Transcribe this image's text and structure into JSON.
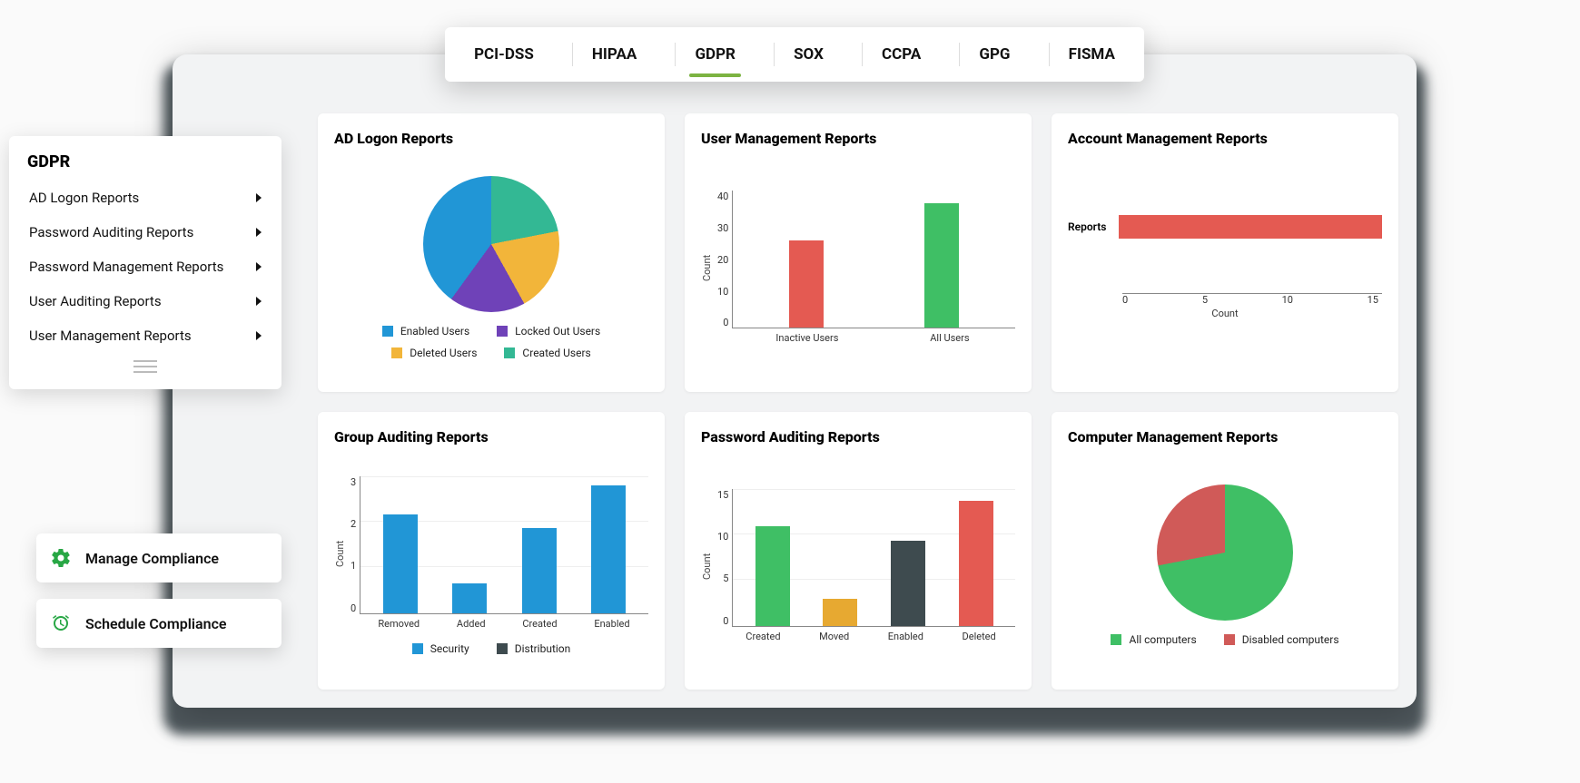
{
  "tabs": [
    "PCI-DSS",
    "HIPAA",
    "GDPR",
    "SOX",
    "CCPA",
    "GPG",
    "FISMA"
  ],
  "active_tab": "GDPR",
  "sidebar": {
    "title": "GDPR",
    "items": [
      "AD Logon Reports",
      "Password Auditing Reports",
      "Password Management Reports",
      "User Auditing Reports",
      "User Management Reports"
    ]
  },
  "actions": {
    "manage": "Manage Compliance",
    "schedule": "Schedule Compliance"
  },
  "cards": {
    "ad_logon": {
      "title": "AD Logon Reports",
      "legend": [
        "Enabled Users",
        "Locked Out Users",
        "Deleted Users",
        "Created Users"
      ]
    },
    "user_mgmt": {
      "title": "User Management Reports",
      "ylabel": "Count",
      "yticks": [
        "40",
        "30",
        "20",
        "10",
        "0"
      ],
      "categories": [
        "Inactive Users",
        "All Users"
      ]
    },
    "acct_mgmt": {
      "title": "Account Management Reports",
      "row_label": "Reports",
      "xlabel": "Count",
      "xticks": [
        "0",
        "5",
        "10",
        "15"
      ]
    },
    "group_audit": {
      "title": "Group Auditing Reports",
      "ylabel": "Count",
      "yticks": [
        "3",
        "2",
        "1",
        "0"
      ],
      "categories": [
        "Removed",
        "Added",
        "Created",
        "Enabled"
      ],
      "legend": [
        "Security",
        "Distribution"
      ]
    },
    "pwd_audit": {
      "title": "Password Auditing Reports",
      "ylabel": "Count",
      "yticks": [
        "15",
        "10",
        "5",
        "0"
      ],
      "categories": [
        "Created",
        "Moved",
        "Enabled",
        "Deleted"
      ]
    },
    "comp_mgmt": {
      "title": "Computer Management Reports",
      "legend": [
        "All computers",
        "Disabled computers"
      ]
    }
  },
  "colors": {
    "blue": "#2196d6",
    "purple": "#6f42b8",
    "yellow": "#f2b53a",
    "teal": "#33b894",
    "green": "#3fbf65",
    "orange": "#e7a931",
    "dark": "#3e4b4f",
    "red": "#e45a52",
    "accent_green": "#28a745"
  },
  "chart_data": [
    {
      "id": "ad_logon",
      "type": "pie",
      "title": "AD Logon Reports",
      "series": [
        {
          "name": "Enabled Users",
          "value": 40,
          "color": "#2196d6"
        },
        {
          "name": "Deleted Users",
          "value": 20,
          "color": "#f2b53a"
        },
        {
          "name": "Created Users",
          "value": 22,
          "color": "#33b894"
        },
        {
          "name": "Locked Out Users",
          "value": 18,
          "color": "#6f42b8"
        }
      ]
    },
    {
      "id": "user_mgmt",
      "type": "bar",
      "title": "User Management Reports",
      "ylabel": "Count",
      "ylim": [
        0,
        45
      ],
      "categories": [
        "Inactive Users",
        "All Users"
      ],
      "series": [
        {
          "name": "Inactive Users",
          "value": 29,
          "color": "#e45a52"
        },
        {
          "name": "All Users",
          "value": 41,
          "color": "#3fbf65"
        }
      ]
    },
    {
      "id": "acct_mgmt",
      "type": "bar",
      "orientation": "horizontal",
      "title": "Account Management Reports",
      "xlabel": "Count",
      "xlim": [
        0,
        15
      ],
      "categories": [
        "Reports"
      ],
      "values": [
        15
      ],
      "color": "#e45a52"
    },
    {
      "id": "group_audit",
      "type": "bar",
      "title": "Group Auditing Reports",
      "ylabel": "Count",
      "ylim": [
        0,
        3
      ],
      "categories": [
        "Removed",
        "Added",
        "Created",
        "Enabled"
      ],
      "series": [
        {
          "name": "Security",
          "color": "#2196d6",
          "values": [
            2.15,
            0.65,
            1.85,
            2.8
          ]
        },
        {
          "name": "Distribution",
          "color": "#3e4b4f",
          "values": [
            0,
            0,
            0,
            0
          ]
        }
      ]
    },
    {
      "id": "pwd_audit",
      "type": "bar",
      "title": "Password Auditing Reports",
      "ylabel": "Count",
      "ylim": [
        0,
        15
      ],
      "categories": [
        "Created",
        "Moved",
        "Enabled",
        "Deleted"
      ],
      "series": [
        {
          "name": "Created",
          "value": 11,
          "color": "#3fbf65"
        },
        {
          "name": "Moved",
          "value": 3,
          "color": "#e7a931"
        },
        {
          "name": "Enabled",
          "value": 9.3,
          "color": "#3e4b4f"
        },
        {
          "name": "Deleted",
          "value": 13.7,
          "color": "#e45a52"
        }
      ]
    },
    {
      "id": "comp_mgmt",
      "type": "pie",
      "title": "Computer Management Reports",
      "series": [
        {
          "name": "All computers",
          "value": 72,
          "color": "#3fbf65"
        },
        {
          "name": "Disabled computers",
          "value": 28,
          "color": "#d05a58"
        }
      ]
    }
  ]
}
